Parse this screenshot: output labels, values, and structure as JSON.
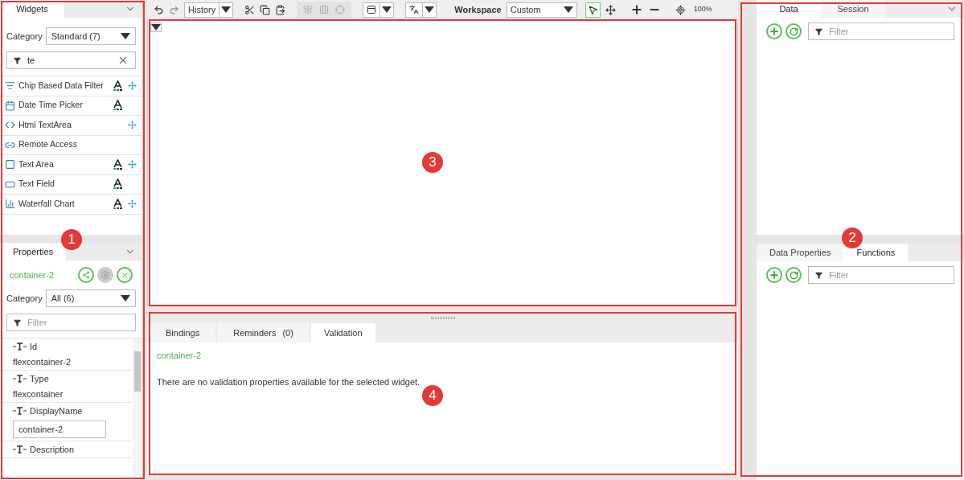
{
  "widgets_panel": {
    "tabs": [
      {
        "label": "Widgets",
        "selected": true
      }
    ],
    "category_label": "Category",
    "category_value": "Standard (7)",
    "filter_value": "te",
    "items": [
      {
        "label": "Chip Based Data Filter",
        "style": true,
        "responsive": true
      },
      {
        "label": "Date Time Picker",
        "style": true,
        "responsive": false
      },
      {
        "label": "Html TextArea",
        "style": false,
        "responsive": true
      },
      {
        "label": "Remote Access",
        "style": false,
        "responsive": false
      },
      {
        "label": "Text Area",
        "style": true,
        "responsive": true
      },
      {
        "label": "Text Field",
        "style": true,
        "responsive": false
      },
      {
        "label": "Waterfall Chart",
        "style": true,
        "responsive": true
      }
    ]
  },
  "properties_panel": {
    "tabs": [
      {
        "label": "Properties",
        "selected": true
      }
    ],
    "widget_name": "container-2",
    "category_label": "Category",
    "category_value": "All (6)",
    "filter_placeholder": "Filter",
    "properties": [
      {
        "kind": "text",
        "label": "Id",
        "value": "flexcontainer-2"
      },
      {
        "kind": "text",
        "label": "Type",
        "value": "flexcontainer"
      },
      {
        "kind": "input",
        "label": "DisplayName",
        "value": "container-2"
      },
      {
        "kind": "none",
        "label": "Description"
      }
    ]
  },
  "toolbar": {
    "history": "History",
    "workspace_label": "Workspace",
    "workspace_value": "Custom",
    "zoom": "100%"
  },
  "bottom_panel": {
    "tabs": [
      {
        "label": "Bindings",
        "selected": false
      },
      {
        "label": "Reminders",
        "count": "(0)",
        "selected": false
      },
      {
        "label": "Validation",
        "selected": true
      }
    ],
    "widget_name": "container-2",
    "message": "There are no validation properties available for the selected widget."
  },
  "data_panel": {
    "tabs": [
      {
        "label": "Data",
        "selected": true
      },
      {
        "label": "Session",
        "selected": false
      }
    ],
    "filter_placeholder": "Filter"
  },
  "functions_panel": {
    "tabs": [
      {
        "label": "Data Properties",
        "selected": false
      },
      {
        "label": "Functions",
        "selected": true
      }
    ],
    "filter_placeholder": "Filter"
  },
  "callouts": [
    "1",
    "2",
    "3",
    "4"
  ]
}
